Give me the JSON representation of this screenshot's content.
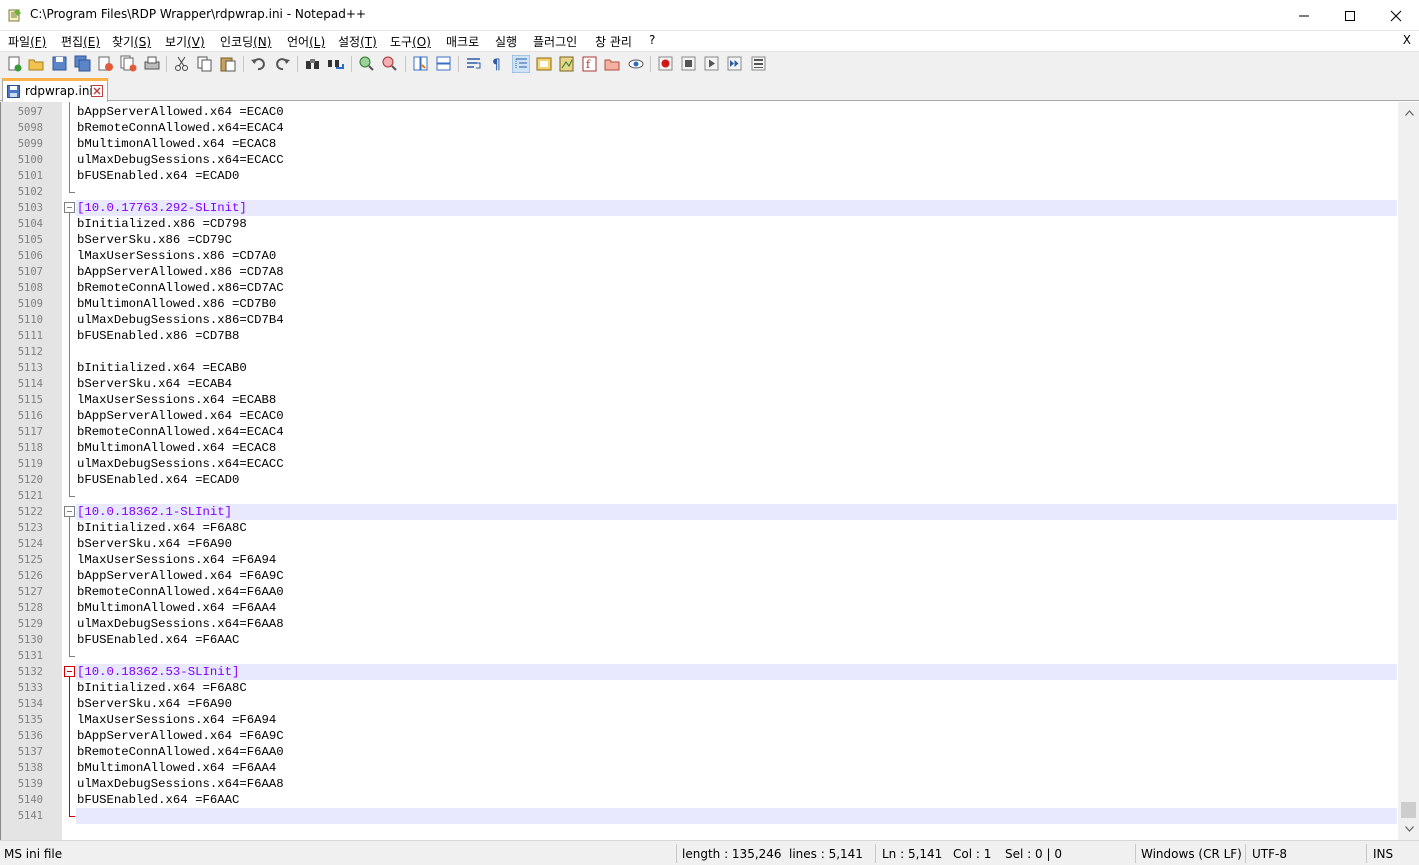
{
  "window": {
    "title": "C:\\Program Files\\RDP Wrapper\\rdpwrap.ini - Notepad++"
  },
  "menu": [
    {
      "label": "파일",
      "mnemonic": "(F)"
    },
    {
      "label": "편집",
      "mnemonic": "(E)"
    },
    {
      "label": "찾기",
      "mnemonic": "(S)"
    },
    {
      "label": "보기",
      "mnemonic": "(V)"
    },
    {
      "label": "인코딩",
      "mnemonic": "(N)"
    },
    {
      "label": "언어",
      "mnemonic": "(L)"
    },
    {
      "label": "설정",
      "mnemonic": "(T)"
    },
    {
      "label": "도구",
      "mnemonic": "(O)"
    },
    {
      "label": "매크로",
      "mnemonic": ""
    },
    {
      "label": "실행",
      "mnemonic": ""
    },
    {
      "label": "플러그인",
      "mnemonic": ""
    },
    {
      "label": "창 관리",
      "mnemonic": ""
    },
    {
      "label": "?",
      "mnemonic": ""
    }
  ],
  "menu_close": "X",
  "tab": {
    "label": "rdpwrap.ini"
  },
  "lines": [
    {
      "n": "5097",
      "text": "bAppServerAllowed.x64 =ECAC0"
    },
    {
      "n": "5098",
      "text": "bRemoteConnAllowed.x64=ECAC4"
    },
    {
      "n": "5099",
      "text": "bMultimonAllowed.x64 =ECAC8"
    },
    {
      "n": "5100",
      "text": "ulMaxDebugSessions.x64=ECACC"
    },
    {
      "n": "5101",
      "text": "bFUSEnabled.x64 =ECAD0"
    },
    {
      "n": "5102",
      "text": ""
    },
    {
      "n": "5103",
      "text": "[10.0.17763.292-SLInit]"
    },
    {
      "n": "5104",
      "text": "bInitialized.x86 =CD798"
    },
    {
      "n": "5105",
      "text": "bServerSku.x86 =CD79C"
    },
    {
      "n": "5106",
      "text": "lMaxUserSessions.x86 =CD7A0"
    },
    {
      "n": "5107",
      "text": "bAppServerAllowed.x86 =CD7A8"
    },
    {
      "n": "5108",
      "text": "bRemoteConnAllowed.x86=CD7AC"
    },
    {
      "n": "5109",
      "text": "bMultimonAllowed.x86 =CD7B0"
    },
    {
      "n": "5110",
      "text": "ulMaxDebugSessions.x86=CD7B4"
    },
    {
      "n": "5111",
      "text": "bFUSEnabled.x86 =CD7B8"
    },
    {
      "n": "5112",
      "text": ""
    },
    {
      "n": "5113",
      "text": "bInitialized.x64 =ECAB0"
    },
    {
      "n": "5114",
      "text": "bServerSku.x64 =ECAB4"
    },
    {
      "n": "5115",
      "text": "lMaxUserSessions.x64 =ECAB8"
    },
    {
      "n": "5116",
      "text": "bAppServerAllowed.x64 =ECAC0"
    },
    {
      "n": "5117",
      "text": "bRemoteConnAllowed.x64=ECAC4"
    },
    {
      "n": "5118",
      "text": "bMultimonAllowed.x64 =ECAC8"
    },
    {
      "n": "5119",
      "text": "ulMaxDebugSessions.x64=ECACC"
    },
    {
      "n": "5120",
      "text": "bFUSEnabled.x64 =ECAD0"
    },
    {
      "n": "5121",
      "text": ""
    },
    {
      "n": "5122",
      "text": "[10.0.18362.1-SLInit]"
    },
    {
      "n": "5123",
      "text": "bInitialized.x64 =F6A8C"
    },
    {
      "n": "5124",
      "text": "bServerSku.x64 =F6A90"
    },
    {
      "n": "5125",
      "text": "lMaxUserSessions.x64 =F6A94"
    },
    {
      "n": "5126",
      "text": "bAppServerAllowed.x64 =F6A9C"
    },
    {
      "n": "5127",
      "text": "bRemoteConnAllowed.x64=F6AA0"
    },
    {
      "n": "5128",
      "text": "bMultimonAllowed.x64 =F6AA4"
    },
    {
      "n": "5129",
      "text": "ulMaxDebugSessions.x64=F6AA8"
    },
    {
      "n": "5130",
      "text": "bFUSEnabled.x64 =F6AAC"
    },
    {
      "n": "5131",
      "text": ""
    },
    {
      "n": "5132",
      "text": "[10.0.18362.53-SLInit]"
    },
    {
      "n": "5133",
      "text": "bInitialized.x64 =F6A8C"
    },
    {
      "n": "5134",
      "text": "bServerSku.x64 =F6A90"
    },
    {
      "n": "5135",
      "text": "lMaxUserSessions.x64 =F6A94"
    },
    {
      "n": "5136",
      "text": "bAppServerAllowed.x64 =F6A9C"
    },
    {
      "n": "5137",
      "text": "bRemoteConnAllowed.x64=F6AA0"
    },
    {
      "n": "5138",
      "text": "bMultimonAllowed.x64 =F6AA4"
    },
    {
      "n": "5139",
      "text": "ulMaxDebugSessions.x64=F6AA8"
    },
    {
      "n": "5140",
      "text": "bFUSEnabled.x64 =F6AAC"
    },
    {
      "n": "5141",
      "text": ""
    }
  ],
  "status": {
    "file_type": "MS ini file",
    "length": "length : 135,246",
    "lines": "lines : 5,141",
    "ln": "Ln : 5,141",
    "col": "Col : 1",
    "sel": "Sel : 0 | 0",
    "eol": "Windows (CR LF)",
    "encoding": "UTF-8",
    "mode": "INS"
  },
  "colors": {
    "section": "#8000ff",
    "gutter": "#e4e4e4",
    "current_line": "#e8e8ff",
    "tab_accent": "#fab24a",
    "fold_active": "#cc0000"
  },
  "toolbar_icons": [
    "new-file-icon",
    "open-file-icon",
    "save-icon",
    "save-all-icon",
    "close-icon",
    "close-all-icon",
    "print-icon",
    "cut-icon",
    "copy-icon",
    "paste-icon",
    "undo-icon",
    "redo-icon",
    "find-icon",
    "replace-icon",
    "zoom-in-icon",
    "zoom-out-icon",
    "sync-vertical-icon",
    "sync-horizontal-icon",
    "word-wrap-icon",
    "show-all-chars-icon",
    "indent-guide-icon",
    "udl-icon",
    "doc-map-icon",
    "function-list-icon",
    "folder-workspace-icon",
    "monitoring-icon",
    "record-macro-icon",
    "stop-record-icon",
    "play-macro-icon",
    "run-macro-multiple-icon",
    "save-macro-icon"
  ]
}
